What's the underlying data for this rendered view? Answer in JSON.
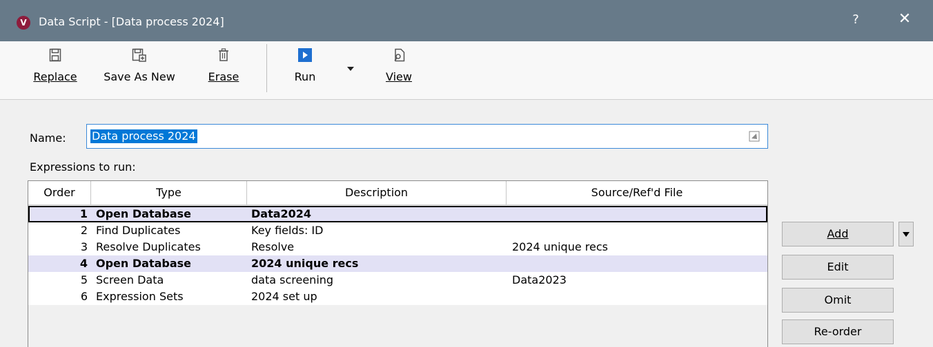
{
  "window": {
    "title": "Data Script - [Data process 2024]",
    "app_icon_letter": "V",
    "help_label": "?",
    "close_label": "✕"
  },
  "toolbar": {
    "replace_label": "Replace",
    "save_as_new_label": "Save As New",
    "erase_label": "Erase",
    "run_label": "Run",
    "view_label": "View"
  },
  "form": {
    "name_label": "Name:",
    "name_value": "Data process 2024",
    "expressions_label": "Expressions to run:"
  },
  "grid": {
    "headers": [
      "Order",
      "Type",
      "Description",
      "Source/Ref'd File"
    ],
    "rows": [
      {
        "order": "1",
        "type": "Open Database",
        "description": "Data2024",
        "source": ""
      },
      {
        "order": "2",
        "type": "Find Duplicates",
        "description": "Key fields: ID",
        "source": ""
      },
      {
        "order": "3",
        "type": "Resolve Duplicates",
        "description": "Resolve",
        "source": "2024 unique recs"
      },
      {
        "order": "4",
        "type": "Open Database",
        "description": "2024 unique recs",
        "source": ""
      },
      {
        "order": "5",
        "type": "Screen Data",
        "description": "data screening",
        "source": "Data2023"
      },
      {
        "order": "6",
        "type": "Expression Sets",
        "description": "2024 set up",
        "source": ""
      }
    ]
  },
  "actions": {
    "add_label": "Add",
    "edit_label": "Edit",
    "omit_label": "Omit",
    "reorder_label": "Re-order"
  },
  "colors": {
    "titlebar": "#677a89",
    "app_icon": "#8e1c3c",
    "selection": "#0078d7",
    "bold_row": "#e2e1f5",
    "run_icon": "#1e6fd0"
  }
}
